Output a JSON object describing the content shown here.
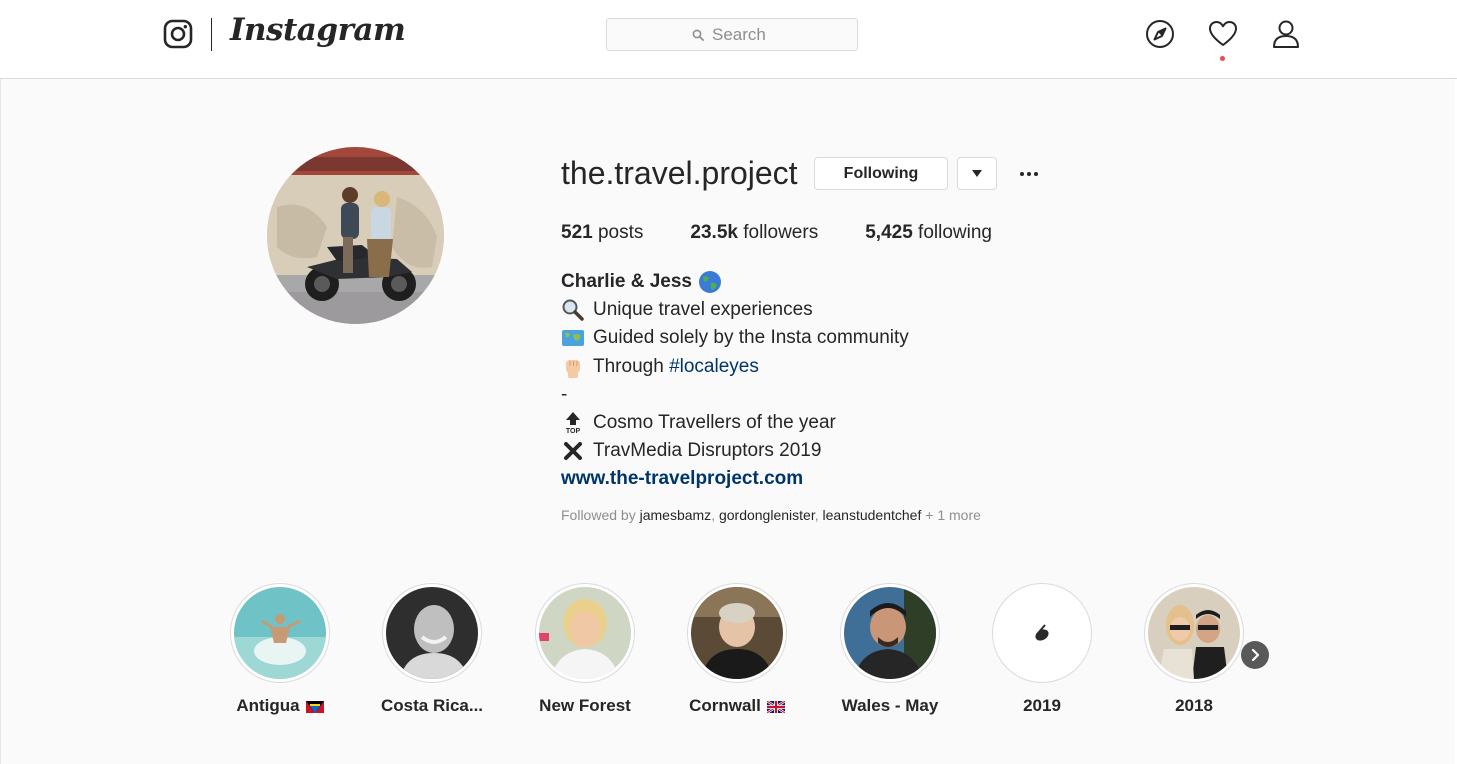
{
  "header": {
    "wordmark": "Instagram",
    "logo_icon": "instagram-camera-icon",
    "search_placeholder": "Search",
    "nav_icons": [
      "compass-icon",
      "heart-icon",
      "profile-icon"
    ],
    "notification_dot_color": "#ed4956"
  },
  "profile": {
    "username": "the.travel.project",
    "following_button": "Following",
    "stats": {
      "posts_count": "521",
      "posts_label": "posts",
      "followers_count": "23.5k",
      "followers_label": "followers",
      "following_count": "5,425",
      "following_label": "following"
    },
    "bio": {
      "name": "Charlie & Jess",
      "line1": "Unique travel experiences",
      "line2": "Guided solely by the Insta community",
      "line3_prefix": "Through",
      "hashtag": "#localeyes",
      "line4": "-",
      "line5": "Cosmo Travellers of the year",
      "line6": "TravMedia Disruptors 2019",
      "website": "www.the-travelproject.com"
    },
    "followed_by": {
      "prefix": "Followed by",
      "user1": "jamesbamz",
      "user2": "gordonglenister",
      "user3": "leanstudentchef",
      "more": "+ 1 more"
    }
  },
  "highlights": [
    {
      "label": "Antigua",
      "flag": "antigua-flag"
    },
    {
      "label": "Costa Rica..."
    },
    {
      "label": "New Forest"
    },
    {
      "label": "Cornwall",
      "flag": "uk-flag"
    },
    {
      "label": "Wales - May"
    },
    {
      "label": "2019"
    },
    {
      "label": "2018"
    }
  ],
  "colors": {
    "link": "#003569",
    "border": "#dbdbdb",
    "background": "#fafafa",
    "text": "#262626",
    "muted": "#8e8e8e"
  }
}
